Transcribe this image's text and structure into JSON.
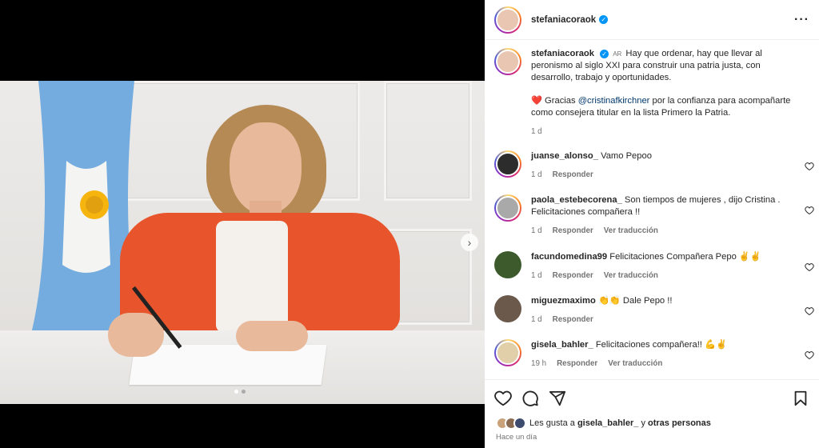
{
  "post": {
    "author": "stefaniacoraok",
    "caption_badge": "AR",
    "caption_text": "Hay que ordenar, hay que llevar al peronismo al siglo XXI para construir una patria justa, con desarrollo, trabajo y oportunidades.",
    "caption_thanks_prefix": "Gracias",
    "caption_mention": "@cristinafkirchner",
    "caption_thanks_suffix": "por la confianza para acompañarte como consejera titular en la lista Primero la Patria.",
    "caption_time": "1 d"
  },
  "comments": [
    {
      "user": "juanse_alonso_",
      "text": "Vamo Pepoo",
      "time": "1 d",
      "reply": "Responder",
      "translate": ""
    },
    {
      "user": "paola_estebecorena_",
      "text": "Son tiempos de mujeres , dijo Cristina . Felicitaciones compañera !!",
      "time": "1 d",
      "reply": "Responder",
      "translate": "Ver traducción"
    },
    {
      "user": "facundomedina99",
      "text": "Felicitaciones Compañera Pepo ✌✌",
      "time": "1 d",
      "reply": "Responder",
      "translate": "Ver traducción"
    },
    {
      "user": "miguezmaximo",
      "text": "👏👏 Dale Pepo !!",
      "time": "1 d",
      "reply": "Responder",
      "translate": ""
    },
    {
      "user": "gisela_bahler_",
      "text": "Felicitaciones compañera!! 💪✌",
      "time": "19 h",
      "reply": "Responder",
      "translate": "Ver traducción"
    }
  ],
  "likes": {
    "prefix": "Les gusta a",
    "user": "gisela_bahler_",
    "middle": "y",
    "others": "otras personas"
  },
  "posted_when": "Hace un día",
  "icons": [
    "like-icon",
    "comment-icon",
    "share-icon",
    "save-icon",
    "more-icon",
    "verified-icon",
    "next-icon",
    "heart-small-icon"
  ],
  "colors": {
    "verified": "#0095f6",
    "mention": "#00376b",
    "secondary_text": "#737373",
    "heart_red": "#ed4956"
  },
  "carousel": {
    "slides": 2,
    "current": 1
  }
}
